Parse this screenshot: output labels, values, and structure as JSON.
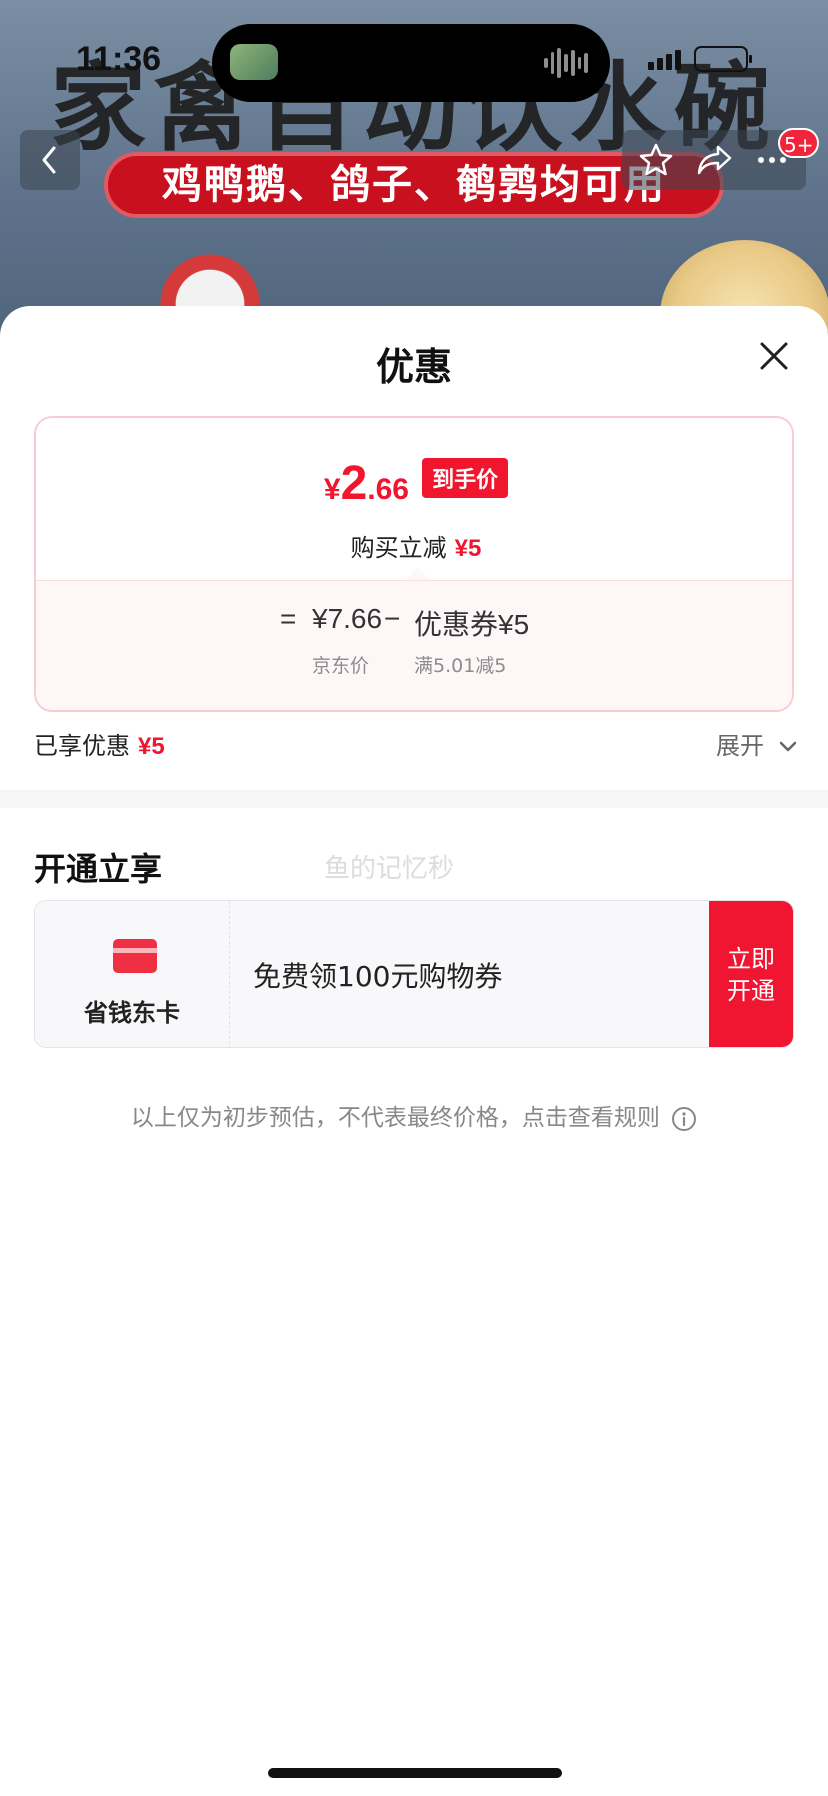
{
  "status_bar": {
    "time": "11:36"
  },
  "background_banner": {
    "title": "家禽自动饮水碗",
    "ribbon": "鸡鸭鹅、鸽子、鹌鹑均可用"
  },
  "nav": {
    "back_icon": "chevron-left-icon",
    "favorite_icon": "star-icon",
    "share_icon": "share-icon",
    "more_icon": "more-dots-icon",
    "badge": "5+"
  },
  "sheet": {
    "title": "优惠",
    "close_icon": "close-icon",
    "price_card": {
      "currency": "¥",
      "price_int": "2",
      "price_dec": ".66",
      "final_price_tag": "到手价",
      "instant_label": "购买立减",
      "instant_amount": "¥5",
      "equals": "=",
      "jd_price": "¥7.66",
      "minus": "−",
      "coupon_label": "优惠券¥5",
      "jd_price_label": "京东价",
      "coupon_condition": "满5.01减5"
    },
    "enjoyed_label": "已享优惠",
    "enjoyed_amount": "¥5",
    "expand_label": "展开",
    "open_section": {
      "title": "开通立享",
      "watermark": "鱼的记忆秒",
      "card_name": "省钱东卡",
      "card_desc": "免费领100元购物券",
      "open_button": "立即\n开通"
    },
    "disclaimer": "以上仅为初步预估，不代表最终价格，点击查看规则"
  },
  "colors": {
    "accent_red": "#f0162e",
    "card_border": "#f8cdd2",
    "text_primary": "#111111",
    "text_muted": "#888888"
  }
}
